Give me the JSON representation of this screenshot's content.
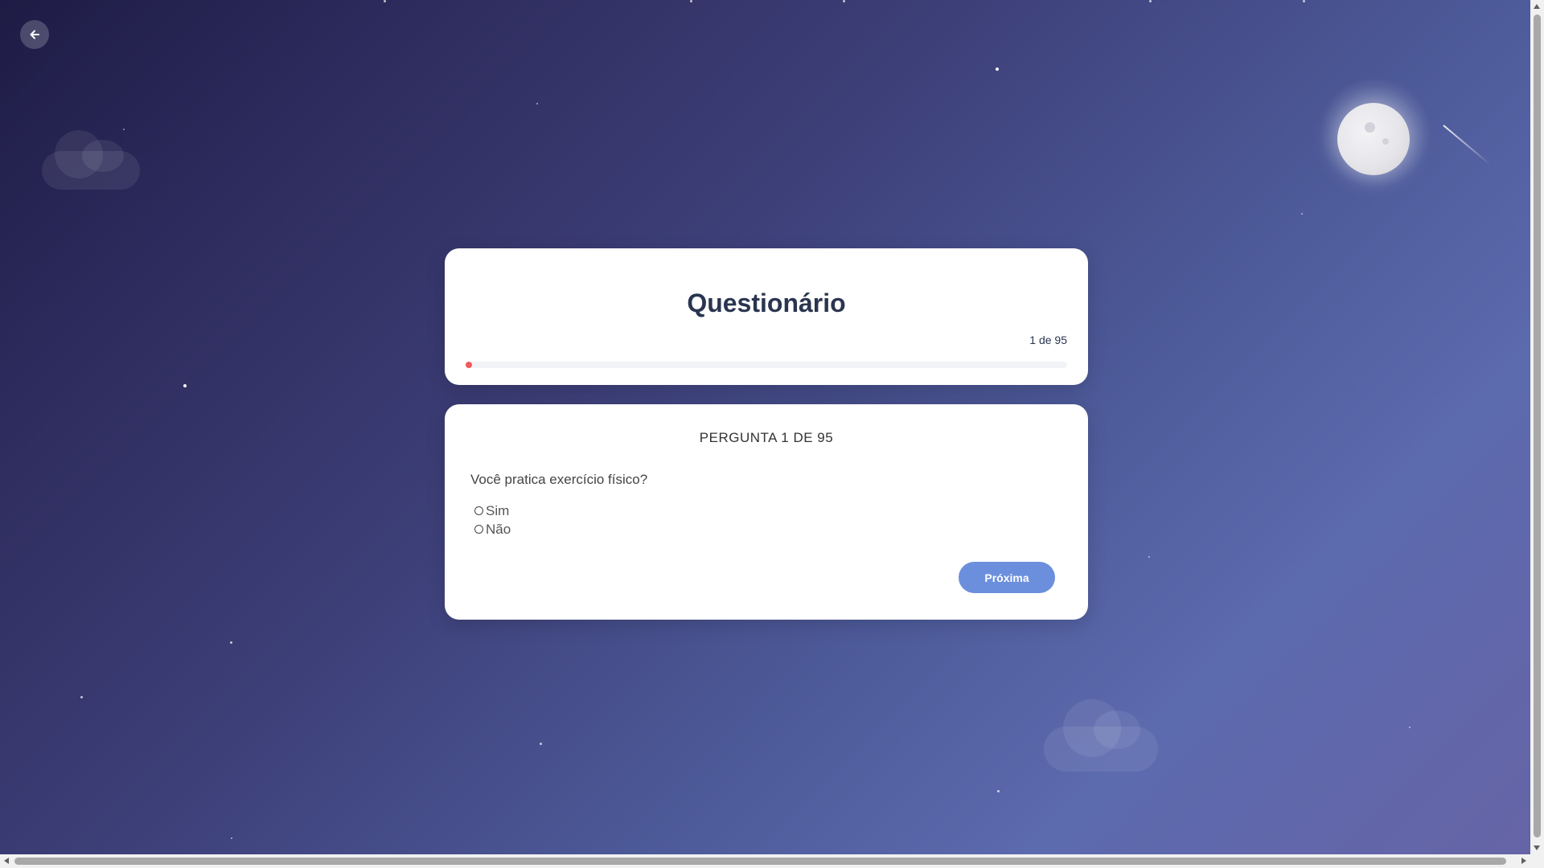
{
  "header": {
    "title": "Questionário",
    "counter": "1 de 95",
    "progress_fraction": 0.0105
  },
  "question": {
    "label": "PERGUNTA 1 DE 95",
    "text": "Você pratica exercício físico?",
    "options": [
      {
        "label": "Sim"
      },
      {
        "label": "Não"
      }
    ],
    "next_label": "Próxima"
  },
  "icons": {
    "back": "arrow-left-icon"
  },
  "colors": {
    "progress_fill": "#f05a5a",
    "next_button": "#6c8fdd",
    "title": "#2a3550"
  }
}
